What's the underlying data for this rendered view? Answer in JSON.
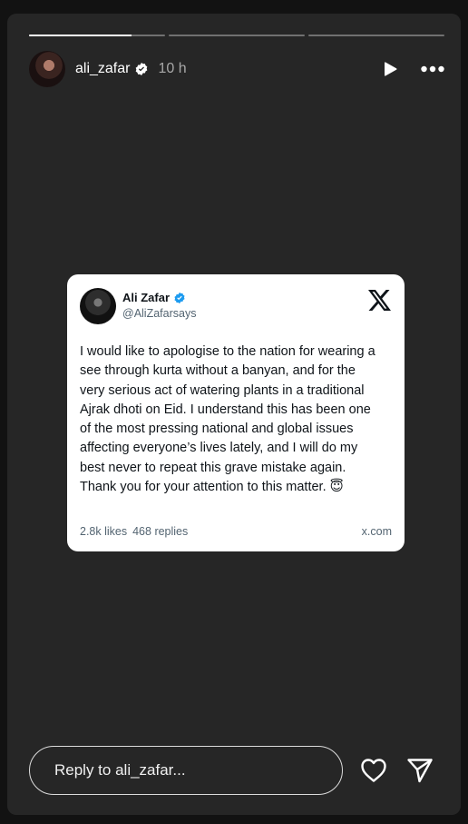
{
  "story": {
    "progress": [
      0.75,
      0,
      0
    ]
  },
  "header": {
    "username": "ali_zafar",
    "time": "10 h",
    "icons": [
      "verified-badge-icon",
      "play-icon",
      "more-options-icon"
    ]
  },
  "tweet": {
    "name": "Ali Zafar",
    "handle": "@AliZafarsays",
    "text": "I would like to apologise to the nation for wearing a\nsee through kurta without a banyan, and for the\nvery serious act of watering plants in a traditional\nAjrak dhoti on Eid. I understand this has been one\nof the most pressing national and global issues\naffecting everyone’s lives lately, and I will do my\nbest never to repeat this grave mistake again.\nThank you for your attention to this matter. 😇",
    "likes": "2.8k likes",
    "replies": "468 replies",
    "domain": "x.com"
  },
  "footer": {
    "reply_placeholder": "Reply to ali_zafar...",
    "icons": [
      "heart-icon",
      "send-icon"
    ]
  },
  "colors": {
    "background": "#121212",
    "story_bg": "#262626",
    "verified_blue": "#1d9bf0"
  }
}
